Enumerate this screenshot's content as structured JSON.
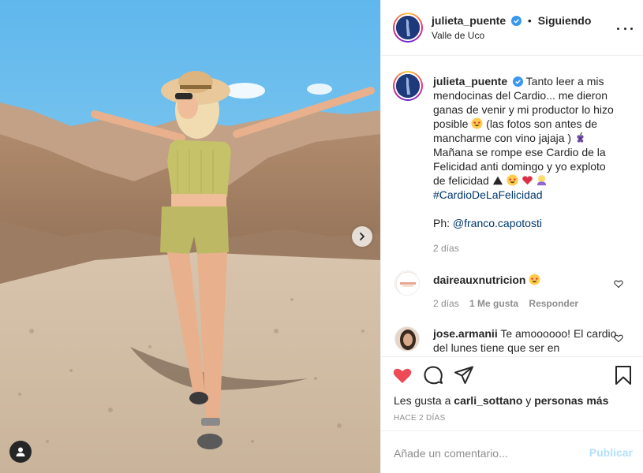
{
  "header": {
    "username": "julieta_puente",
    "follow_separator": "•",
    "follow_state": "Siguiendo",
    "location": "Valle de Uco"
  },
  "caption": {
    "username": "julieta_puente",
    "text_1": "Tanto leer a mis mendocinas del Cardio... me dieron ganas de venir y mi productor lo hizo posible",
    "text_2": "(las fotos son antes de mancharme con vino jajaja )",
    "text_3": "Mañana se rompe ese Cardio de la Felicidad anti domingo y yo exploto de felicidad",
    "hashtag": "#CardioDeLaFelicidad",
    "ph_label": "Ph: ",
    "ph_mention": "@franco.capotosti",
    "time": "2 días"
  },
  "comments": [
    {
      "username": "daireauxnutricion",
      "text": "",
      "time": "2 días",
      "likes": "1 Me gusta",
      "reply": "Responder"
    },
    {
      "username": "jose.armanii",
      "text": "Te amoooooo! El cardio del lunes tiene que ser en"
    }
  ],
  "actions": {
    "liked_by_prefix": "Les gusta a ",
    "liked_by_user": "carli_sottano",
    "liked_by_mid": " y ",
    "liked_by_others": "personas más",
    "timestamp": "HACE 2 DÍAS"
  },
  "add_comment": {
    "placeholder": "Añade un comentario...",
    "publish_label": "Publicar"
  },
  "colors": {
    "like_red": "#ed4956",
    "link_blue": "#00376b",
    "publish_disabled": "#b2dffc",
    "verified_blue": "#3897f0"
  },
  "icons": [
    "chevron-right-icon",
    "user-tag-icon",
    "verified-icon",
    "more-icon",
    "heart-icon",
    "comment-icon",
    "share-icon",
    "bookmark-icon"
  ]
}
